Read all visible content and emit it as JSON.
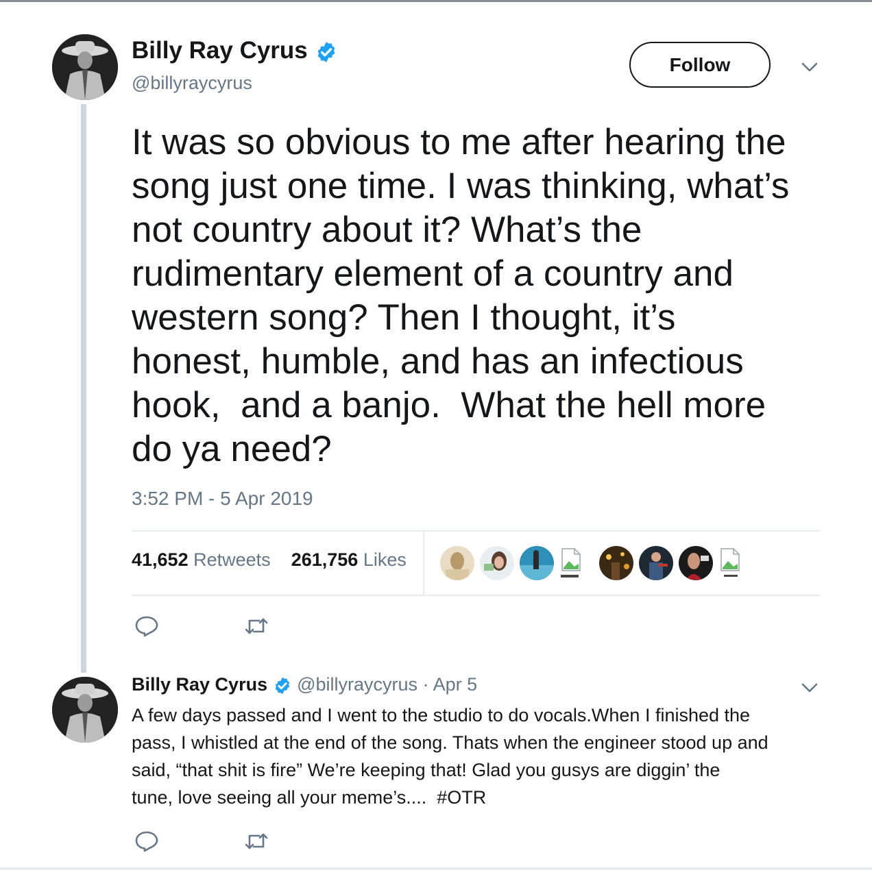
{
  "tweet": {
    "author_name": "Billy Ray Cyrus",
    "author_handle": "@billyraycyrus",
    "verified_icon": "verified-badge-icon",
    "follow_label": "Follow",
    "text_lines": [
      "It was so obvious to me after hearing the",
      "song just one time. I was thinking, what’s",
      "not country about it? What’s the",
      "rudimentary element of a country and",
      "western song? Then I thought, it’s",
      "honest, humble, and has an infectious",
      "hook,  and a banjo.  What the hell more",
      "do ya need?"
    ],
    "timestamp": "3:52 PM - 5 Apr 2019",
    "retweets_count": "41,652",
    "retweets_label": "Retweets",
    "likes_count": "261,756",
    "likes_label": "Likes"
  },
  "reply": {
    "author_name": "Billy Ray Cyrus",
    "author_handle": "@billyraycyrus",
    "date": "· Apr 5",
    "text_lines": [
      "A few days passed and I went to the studio to do vocals.When I finished the",
      "pass, I whistled at the end of the song. Thats when the engineer stood up and",
      "said, “that shit is fire” We’re keeping that! Glad you gusys are diggin’ the",
      "tune, love seeing all your meme’s....  #OTR"
    ]
  },
  "colors": {
    "primary_text": "#14171a",
    "secondary_text": "#657786",
    "verified_blue": "#1da1f2",
    "divider": "#e6ecf0",
    "thread_line": "#ccd6dd"
  }
}
